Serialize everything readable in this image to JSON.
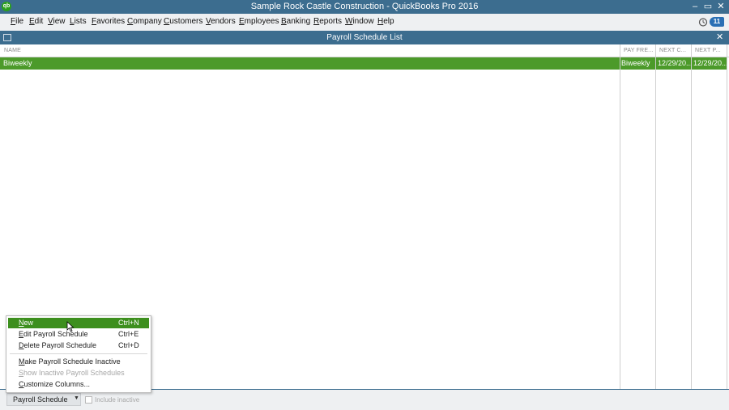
{
  "app": {
    "title": "Sample Rock Castle Construction  - QuickBooks Pro 2016",
    "logo_text": "qb",
    "window_buttons": [
      "–",
      "▭",
      "✕"
    ]
  },
  "menubar": {
    "items": [
      "File",
      "Edit",
      "View",
      "Lists",
      "Favorites",
      "Company",
      "Customers",
      "Vendors",
      "Employees",
      "Banking",
      "Reports",
      "Window",
      "Help"
    ],
    "reminder_count": "11"
  },
  "list_window": {
    "title": "Payroll Schedule List",
    "close": "✕"
  },
  "table": {
    "columns": [
      "NAME",
      "PAY FRE...",
      "NEXT C...",
      "NEXT P..."
    ],
    "rows": [
      {
        "name": "Biweekly",
        "pay_frequency": "Biweekly",
        "next_check": "12/29/20...",
        "next_pay": "12/29/20..."
      }
    ]
  },
  "context_menu": {
    "items": [
      {
        "label": "New",
        "shortcut": "Ctrl+N",
        "state": "highlighted"
      },
      {
        "label": "Edit Payroll Schedule",
        "shortcut": "Ctrl+E",
        "state": "normal"
      },
      {
        "label": "Delete Payroll Schedule",
        "shortcut": "Ctrl+D",
        "state": "normal"
      },
      {
        "label": "Make Payroll Schedule Inactive",
        "shortcut": "",
        "state": "normal"
      },
      {
        "label": "Show Inactive Payroll Schedules",
        "shortcut": "",
        "state": "disabled"
      },
      {
        "label": "Customize Columns...",
        "shortcut": "",
        "state": "normal"
      }
    ]
  },
  "bottom": {
    "button_label": "Payroll Schedule",
    "dropdown_arrow": "▼",
    "include_inactive_label": "Include inactive"
  },
  "colors": {
    "titlebar": "#3c6d8f",
    "selected_row": "#4c9a2a",
    "menu_highlight": "#3d8f1e",
    "badge": "#2a6fb4"
  }
}
